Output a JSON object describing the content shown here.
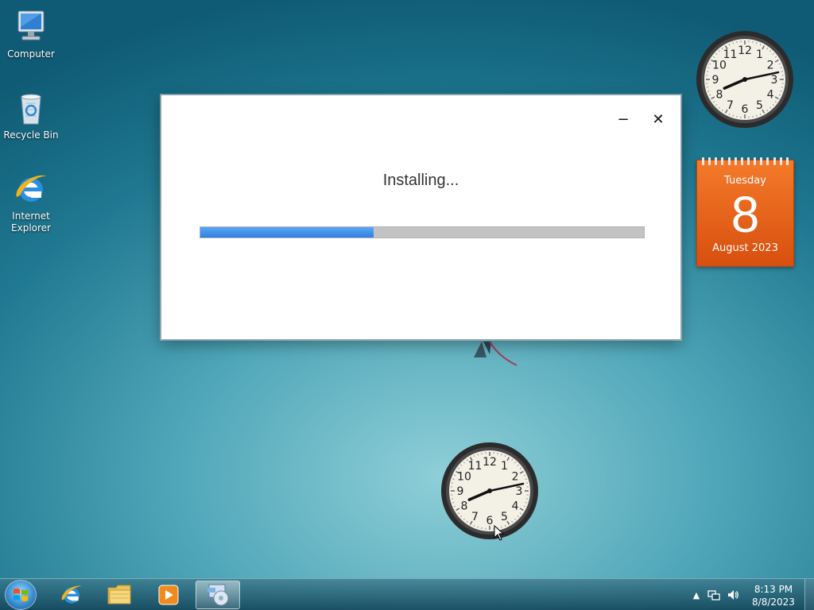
{
  "desktop": {
    "icons": [
      {
        "label": "Computer",
        "icon": "computer-icon"
      },
      {
        "label": "Recycle Bin",
        "icon": "recycle-bin-icon"
      },
      {
        "label": "Internet Explorer",
        "icon": "internet-explorer-icon"
      }
    ]
  },
  "installer": {
    "status_text": "Installing...",
    "progress_fraction": 0.39,
    "minimize_glyph": "−",
    "close_glyph": "✕",
    "accent_color": "#3a8ae8"
  },
  "gadgets": {
    "calendar": {
      "weekday": "Tuesday",
      "day": "8",
      "month_year": "August 2023",
      "color": "#e8621a"
    },
    "clock_numerals": [
      "12",
      "1",
      "2",
      "3",
      "4",
      "5",
      "6",
      "7",
      "8",
      "9",
      "10",
      "11"
    ]
  },
  "taskbar": {
    "pinned": [
      {
        "name": "internet-explorer-icon"
      },
      {
        "name": "file-explorer-icon"
      },
      {
        "name": "media-player-icon"
      },
      {
        "name": "installer-app-icon",
        "active": true
      }
    ],
    "tray": {
      "time": "8:13 PM",
      "date": "8/8/2023"
    }
  }
}
